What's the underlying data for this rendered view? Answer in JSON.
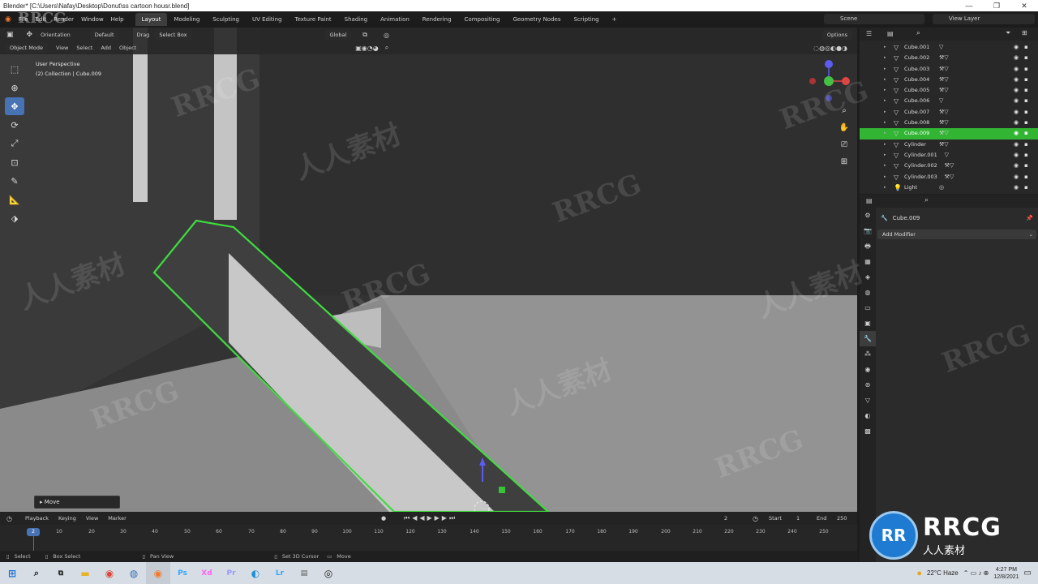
{
  "window": {
    "title": "Blender* [C:\\Users\\Nafay\\Desktop\\Donut\\ss cartoon housr.blend]",
    "controls": [
      "—",
      "❐",
      "✕"
    ]
  },
  "topbar": {
    "menu": [
      "File",
      "Edit",
      "Render",
      "Window",
      "Help"
    ],
    "workspaces": [
      "Layout",
      "Modeling",
      "Sculpting",
      "UV Editing",
      "Texture Paint",
      "Shading",
      "Animation",
      "Rendering",
      "Compositing",
      "Geometry Nodes",
      "Scripting"
    ],
    "active_workspace": "Layout",
    "add_workspace": "+",
    "scene": "Scene",
    "view_layer": "View Layer"
  },
  "viewport": {
    "orientation": "Orientation",
    "orientation_value": "Default",
    "drag_label": "Drag",
    "drag_value": "Select Box",
    "transform_pivot": "Global",
    "options_label": "Options",
    "mode": "Object Mode",
    "header_menus": [
      "View",
      "Select",
      "Add",
      "Object"
    ],
    "info_line1": "User Perspective",
    "info_line2": "(2) Collection | Cube.009",
    "operator_panel": "Move"
  },
  "outliner": {
    "rows": [
      {
        "name": "Cube.001",
        "selected": false,
        "type": "mesh"
      },
      {
        "name": "Cube.002",
        "selected": false,
        "type": "mesh"
      },
      {
        "name": "Cube.003",
        "selected": false,
        "type": "mesh"
      },
      {
        "name": "Cube.004",
        "selected": false,
        "type": "mesh"
      },
      {
        "name": "Cube.005",
        "selected": false,
        "type": "mesh"
      },
      {
        "name": "Cube.006",
        "selected": false,
        "type": "mesh"
      },
      {
        "name": "Cube.007",
        "selected": false,
        "type": "mesh"
      },
      {
        "name": "Cube.008",
        "selected": false,
        "type": "mesh"
      },
      {
        "name": "Cube.009",
        "selected": true,
        "type": "mesh"
      },
      {
        "name": "Cylinder",
        "selected": false,
        "type": "mesh"
      },
      {
        "name": "Cylinder.001",
        "selected": false,
        "type": "mesh"
      },
      {
        "name": "Cylinder.002",
        "selected": false,
        "type": "mesh"
      },
      {
        "name": "Cylinder.003",
        "selected": false,
        "type": "mesh"
      },
      {
        "name": "Light",
        "selected": false,
        "type": "light"
      }
    ],
    "selected_color": "#31b532"
  },
  "properties": {
    "object_name": "Cube.009",
    "add_modifier": "Add Modifier"
  },
  "timeline": {
    "menus": [
      "Playback",
      "Keying",
      "View",
      "Marker"
    ],
    "current_frame": "2",
    "start_label": "Start",
    "start_value": "1",
    "end_label": "End",
    "end_value": "250",
    "cursor_frame": "2",
    "ruler": [
      "10",
      "20",
      "30",
      "40",
      "50",
      "60",
      "70",
      "80",
      "90",
      "100",
      "110",
      "120",
      "130",
      "140",
      "150",
      "160",
      "170",
      "180",
      "190",
      "200",
      "210",
      "220",
      "230",
      "240",
      "250"
    ]
  },
  "statusbar": {
    "items": [
      "Select",
      "Box Select",
      "Pan View",
      "Set 3D Cursor",
      "Move"
    ]
  },
  "taskbar": {
    "weather": "22°C Haze",
    "time": "4:27 PM",
    "date": "12/8/2021",
    "apps": [
      "Ps",
      "Xd",
      "Pr",
      "Lr"
    ]
  },
  "watermark": {
    "brand": "RRCG",
    "cn": "人人素材"
  },
  "colors": {
    "selection_outline": "#3fdc3f",
    "active_tool": "#4772b3"
  }
}
